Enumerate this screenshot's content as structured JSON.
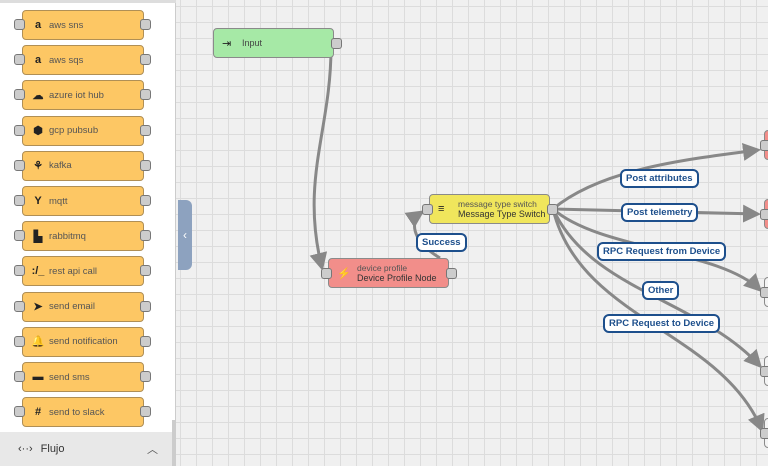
{
  "sidebar": {
    "items": [
      {
        "label": "aws sns",
        "icon": "amazon-icon"
      },
      {
        "label": "aws sqs",
        "icon": "amazon-icon"
      },
      {
        "label": "azure iot hub",
        "icon": "cloud-upload-icon"
      },
      {
        "label": "gcp pubsub",
        "icon": "gcp-pubsub-icon"
      },
      {
        "label": "kafka",
        "icon": "kafka-icon"
      },
      {
        "label": "mqtt",
        "icon": "mqtt-icon"
      },
      {
        "label": "rabbitmq",
        "icon": "rabbitmq-icon"
      },
      {
        "label": "rest api call",
        "icon": "rest-api-icon"
      },
      {
        "label": "send email",
        "icon": "send-icon"
      },
      {
        "label": "send notification",
        "icon": "bell-icon"
      },
      {
        "label": "send sms",
        "icon": "sms-icon"
      },
      {
        "label": "send to slack",
        "icon": "slack-icon"
      }
    ],
    "footer": {
      "label": "Flujo",
      "icon": "code-flow-icon"
    }
  },
  "nodes": {
    "input": {
      "label": "Input",
      "color": "#a6e9a6"
    },
    "device_profile": {
      "type": "device profile",
      "name": "Device Profile Node",
      "color": "#f28e8a"
    },
    "switch": {
      "type": "message type switch",
      "name": "Message Type Switch",
      "color": "#f0e65c"
    }
  },
  "edge_labels": {
    "success": "Success",
    "post_attributes": "Post attributes",
    "post_telemetry": "Post telemetry",
    "rpc_from": "RPC Request from Device",
    "other": "Other",
    "rpc_to": "RPC Request to Device"
  },
  "colors": {
    "library_node": "#fdc764",
    "edge_label": "#1d4f8c"
  }
}
